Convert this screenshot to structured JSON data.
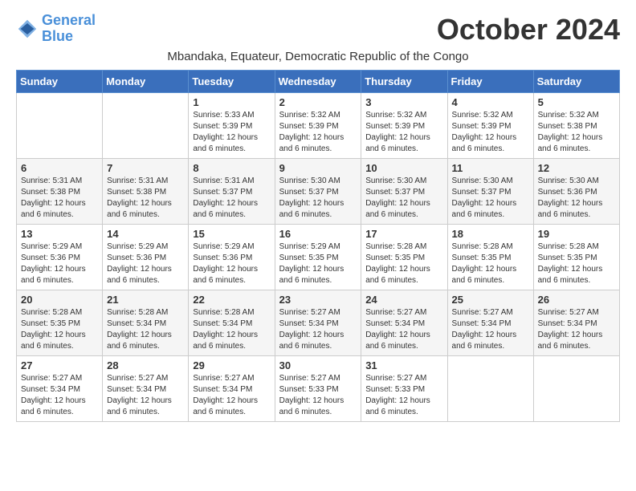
{
  "logo": {
    "line1": "General",
    "line2": "Blue"
  },
  "title": "October 2024",
  "subtitle": "Mbandaka, Equateur, Democratic Republic of the Congo",
  "header": {
    "days": [
      "Sunday",
      "Monday",
      "Tuesday",
      "Wednesday",
      "Thursday",
      "Friday",
      "Saturday"
    ]
  },
  "weeks": [
    [
      {
        "day": "",
        "info": ""
      },
      {
        "day": "",
        "info": ""
      },
      {
        "day": "1",
        "info": "Sunrise: 5:33 AM\nSunset: 5:39 PM\nDaylight: 12 hours\nand 6 minutes."
      },
      {
        "day": "2",
        "info": "Sunrise: 5:32 AM\nSunset: 5:39 PM\nDaylight: 12 hours\nand 6 minutes."
      },
      {
        "day": "3",
        "info": "Sunrise: 5:32 AM\nSunset: 5:39 PM\nDaylight: 12 hours\nand 6 minutes."
      },
      {
        "day": "4",
        "info": "Sunrise: 5:32 AM\nSunset: 5:39 PM\nDaylight: 12 hours\nand 6 minutes."
      },
      {
        "day": "5",
        "info": "Sunrise: 5:32 AM\nSunset: 5:38 PM\nDaylight: 12 hours\nand 6 minutes."
      }
    ],
    [
      {
        "day": "6",
        "info": "Sunrise: 5:31 AM\nSunset: 5:38 PM\nDaylight: 12 hours\nand 6 minutes."
      },
      {
        "day": "7",
        "info": "Sunrise: 5:31 AM\nSunset: 5:38 PM\nDaylight: 12 hours\nand 6 minutes."
      },
      {
        "day": "8",
        "info": "Sunrise: 5:31 AM\nSunset: 5:37 PM\nDaylight: 12 hours\nand 6 minutes."
      },
      {
        "day": "9",
        "info": "Sunrise: 5:30 AM\nSunset: 5:37 PM\nDaylight: 12 hours\nand 6 minutes."
      },
      {
        "day": "10",
        "info": "Sunrise: 5:30 AM\nSunset: 5:37 PM\nDaylight: 12 hours\nand 6 minutes."
      },
      {
        "day": "11",
        "info": "Sunrise: 5:30 AM\nSunset: 5:37 PM\nDaylight: 12 hours\nand 6 minutes."
      },
      {
        "day": "12",
        "info": "Sunrise: 5:30 AM\nSunset: 5:36 PM\nDaylight: 12 hours\nand 6 minutes."
      }
    ],
    [
      {
        "day": "13",
        "info": "Sunrise: 5:29 AM\nSunset: 5:36 PM\nDaylight: 12 hours\nand 6 minutes."
      },
      {
        "day": "14",
        "info": "Sunrise: 5:29 AM\nSunset: 5:36 PM\nDaylight: 12 hours\nand 6 minutes."
      },
      {
        "day": "15",
        "info": "Sunrise: 5:29 AM\nSunset: 5:36 PM\nDaylight: 12 hours\nand 6 minutes."
      },
      {
        "day": "16",
        "info": "Sunrise: 5:29 AM\nSunset: 5:35 PM\nDaylight: 12 hours\nand 6 minutes."
      },
      {
        "day": "17",
        "info": "Sunrise: 5:28 AM\nSunset: 5:35 PM\nDaylight: 12 hours\nand 6 minutes."
      },
      {
        "day": "18",
        "info": "Sunrise: 5:28 AM\nSunset: 5:35 PM\nDaylight: 12 hours\nand 6 minutes."
      },
      {
        "day": "19",
        "info": "Sunrise: 5:28 AM\nSunset: 5:35 PM\nDaylight: 12 hours\nand 6 minutes."
      }
    ],
    [
      {
        "day": "20",
        "info": "Sunrise: 5:28 AM\nSunset: 5:35 PM\nDaylight: 12 hours\nand 6 minutes."
      },
      {
        "day": "21",
        "info": "Sunrise: 5:28 AM\nSunset: 5:34 PM\nDaylight: 12 hours\nand 6 minutes."
      },
      {
        "day": "22",
        "info": "Sunrise: 5:28 AM\nSunset: 5:34 PM\nDaylight: 12 hours\nand 6 minutes."
      },
      {
        "day": "23",
        "info": "Sunrise: 5:27 AM\nSunset: 5:34 PM\nDaylight: 12 hours\nand 6 minutes."
      },
      {
        "day": "24",
        "info": "Sunrise: 5:27 AM\nSunset: 5:34 PM\nDaylight: 12 hours\nand 6 minutes."
      },
      {
        "day": "25",
        "info": "Sunrise: 5:27 AM\nSunset: 5:34 PM\nDaylight: 12 hours\nand 6 minutes."
      },
      {
        "day": "26",
        "info": "Sunrise: 5:27 AM\nSunset: 5:34 PM\nDaylight: 12 hours\nand 6 minutes."
      }
    ],
    [
      {
        "day": "27",
        "info": "Sunrise: 5:27 AM\nSunset: 5:34 PM\nDaylight: 12 hours\nand 6 minutes."
      },
      {
        "day": "28",
        "info": "Sunrise: 5:27 AM\nSunset: 5:34 PM\nDaylight: 12 hours\nand 6 minutes."
      },
      {
        "day": "29",
        "info": "Sunrise: 5:27 AM\nSunset: 5:34 PM\nDaylight: 12 hours\nand 6 minutes."
      },
      {
        "day": "30",
        "info": "Sunrise: 5:27 AM\nSunset: 5:33 PM\nDaylight: 12 hours\nand 6 minutes."
      },
      {
        "day": "31",
        "info": "Sunrise: 5:27 AM\nSunset: 5:33 PM\nDaylight: 12 hours\nand 6 minutes."
      },
      {
        "day": "",
        "info": ""
      },
      {
        "day": "",
        "info": ""
      }
    ]
  ]
}
